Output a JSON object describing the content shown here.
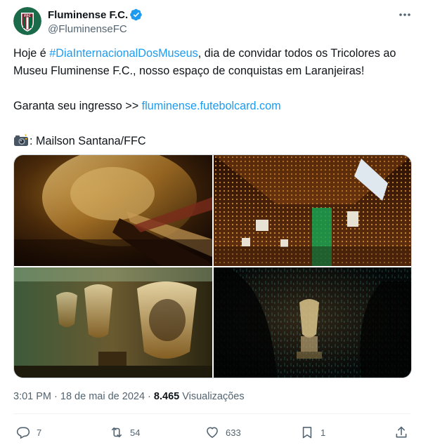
{
  "author": {
    "display_name": "Fluminense F.C.",
    "handle": "@FluminenseFC",
    "verified": true,
    "avatar_icon": "fluminense-crest-icon"
  },
  "tweet": {
    "line1_before": "Hoje é ",
    "hashtag": "#DiaInternacionalDosMuseus",
    "line1_after": ", dia de convidar todos os Tricolores ao",
    "line2": "Museu Fluminense F.C., nosso espaço de conquistas em Laranjeiras!",
    "line3_before": "Garanta seu ingresso >> ",
    "link": "fluminense.futebolcard.com",
    "credit_icon": "camera-flash-icon",
    "credit": ": Mailson Santana/FFC"
  },
  "media": [
    {
      "name": "trophy-closeup-photo"
    },
    {
      "name": "illuminated-hall-photo"
    },
    {
      "name": "trophy-row-photo"
    },
    {
      "name": "dark-trophy-display-photo"
    }
  ],
  "meta": {
    "time": "3:01 PM",
    "separator": " · ",
    "date": "18 de mai de 2024",
    "views_count": "8.465",
    "views_label": " Visualizações"
  },
  "actions": {
    "replies": "7",
    "reposts": "54",
    "likes": "633",
    "bookmarks": "1"
  },
  "colors": {
    "accent": "#1d9bf0",
    "text": "#0f1419",
    "muted": "#536471",
    "club_maroon": "#7a1e2c",
    "club_green": "#006b3c"
  }
}
